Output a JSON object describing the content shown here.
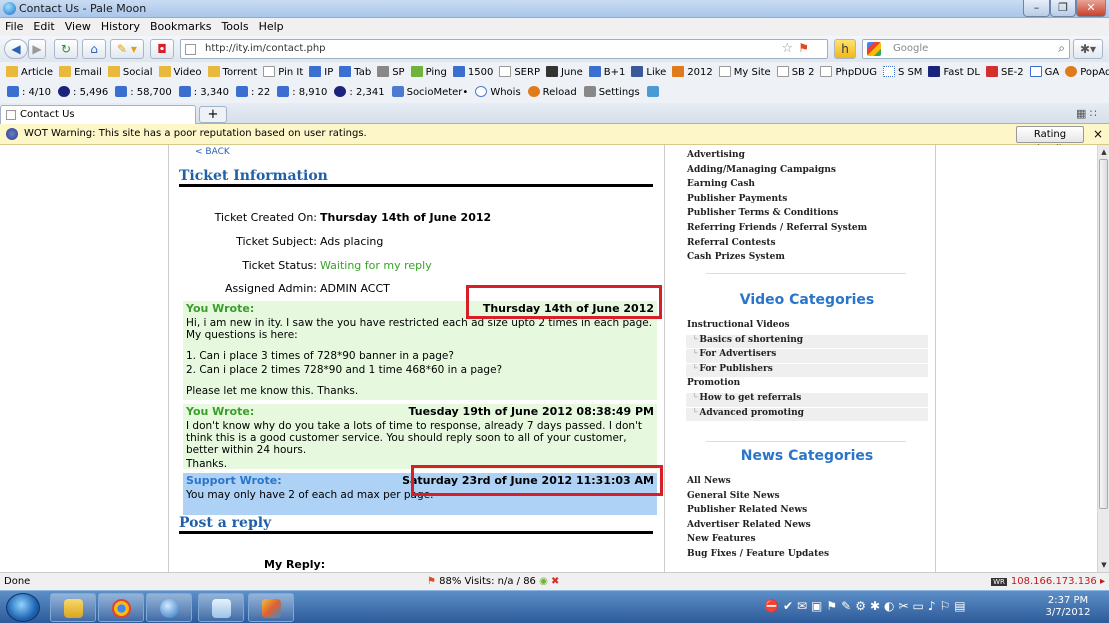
{
  "window": {
    "title": "Contact Us - Pale Moon",
    "controls": [
      "–",
      "❐",
      "✕"
    ]
  },
  "menu": [
    "File",
    "Edit",
    "View",
    "History",
    "Bookmarks",
    "Tools",
    "Help"
  ],
  "nav": {
    "url": "http://ity.im/contact.php",
    "search_placeholder": "Google"
  },
  "bookmarks": [
    {
      "label": "Article",
      "color": "#e8b93b"
    },
    {
      "label": "Email",
      "color": "#e8b93b"
    },
    {
      "label": "Social",
      "color": "#e8b93b"
    },
    {
      "label": "Video",
      "color": "#e8b93b"
    },
    {
      "label": "Torrent",
      "color": "#e8b93b"
    },
    {
      "label": "Pin It",
      "color": "#ffffff"
    },
    {
      "label": "IP",
      "color": "#3a6fd1"
    },
    {
      "label": "Tab",
      "color": "#3a6fd1"
    },
    {
      "label": "SP",
      "color": "#888888"
    },
    {
      "label": "Ping",
      "color": "#6fb33a"
    },
    {
      "label": "1500",
      "color": "#3a6fd1"
    },
    {
      "label": "SERP",
      "color": "#ffffff"
    },
    {
      "label": "June",
      "color": "#333333"
    },
    {
      "label": "B+1",
      "color": "#3a6fd1"
    },
    {
      "label": "Like",
      "color": "#3b5998"
    },
    {
      "label": "2012",
      "color": "#3a6fd1"
    },
    {
      "label": "My Site",
      "color": "#ffffff"
    },
    {
      "label": "SB 2",
      "color": "#ffffff"
    },
    {
      "label": "PhpDUG",
      "color": "#ffffff"
    },
    {
      "label": "S SM",
      "color": "#3a6fd1"
    },
    {
      "label": "Fast DL",
      "color": "#1a237e"
    },
    {
      "label": "SE-2",
      "color": "#d32f2f"
    },
    {
      "label": "GA",
      "color": "#3a6fd1"
    },
    {
      "label": "PopAds",
      "color": "#e07a1b"
    }
  ],
  "stats": [
    {
      "label": ": 4/10",
      "color": "#3a6fd1"
    },
    {
      "label": ": 5,496",
      "color": "#1a237e"
    },
    {
      "label": ": 58,700",
      "color": "#3a6fd1"
    },
    {
      "label": ": 3,340",
      "color": "#3a6fd1"
    },
    {
      "label": ": 22",
      "color": "#3a6fd1"
    },
    {
      "label": ": 8,910",
      "color": "#3a6fd1"
    },
    {
      "label": ": 2,341",
      "color": "#1a237e"
    },
    {
      "label": "SocioMeter•",
      "color": "#4a7bd0"
    },
    {
      "label": "Whois",
      "color": "#4a7bd0"
    },
    {
      "label": "Reload",
      "color": "#e07a1b"
    },
    {
      "label": "Settings",
      "color": "#888888"
    }
  ],
  "tab": {
    "label": "Contact Us",
    "new_tab": "+"
  },
  "wot": {
    "warning": "WOT Warning: This site has a poor reputation based on user ratings.",
    "button": "Rating details",
    "close": "×"
  },
  "page": {
    "back": "< BACK",
    "ticket_title": "Ticket Information",
    "info": [
      {
        "label": "Ticket Created On:",
        "value": "Thursday 14th of June 2012",
        "style": "bold"
      },
      {
        "label": "Ticket Subject:",
        "value": "Ads placing",
        "style": ""
      },
      {
        "label": "Ticket Status:",
        "value": "Waiting for my reply",
        "style": "green"
      },
      {
        "label": "Assigned Admin:",
        "value": "ADMIN ACCT",
        "style": ""
      }
    ],
    "messages": [
      {
        "who": "You Wrote:",
        "when": "Thursday 14th of June 2012",
        "lines": [
          "Hi, i am new in ity. I saw the you have restricted each ad size upto 2 times in each page. My questions is here:",
          "",
          "1. Can i place 3 times of 728*90 banner in a page?",
          "2. Can i place 2 times 728*90 and 1 time 468*60 in a page?",
          "",
          "Please let me know this. Thanks."
        ]
      },
      {
        "who": "You Wrote:",
        "when": "Tuesday 19th of June 2012 08:38:49 PM",
        "lines": [
          "I don't know why do you take a lots of time to response, already 7 days passed. I don't think this is a good customer service. You should reply soon to all of your customer, better within 24 hours.",
          "Thanks."
        ]
      },
      {
        "who": "Support Wrote:",
        "when": "Saturday 23rd of June 2012 11:31:03 AM",
        "lines": [
          "You may only have 2 of each ad max per page."
        ]
      }
    ],
    "reply_title": "Post a reply",
    "reply_label": "My Reply:"
  },
  "sidebar": {
    "top_items": [
      "Advertising",
      "Adding/Managing Campaigns",
      "Earning Cash",
      "Publisher Payments",
      "Publisher Terms & Conditions",
      "Referring Friends / Referral System",
      "Referral Contests",
      "Cash Prizes System"
    ],
    "video_title": "Video Categories",
    "video_items": [
      {
        "label": "Instructional Videos",
        "sub": false
      },
      {
        "label": "Basics of shortening",
        "sub": true
      },
      {
        "label": "For Advertisers",
        "sub": true
      },
      {
        "label": "For Publishers",
        "sub": true
      },
      {
        "label": "Promotion",
        "sub": false
      },
      {
        "label": "How to get referrals",
        "sub": true
      },
      {
        "label": "Advanced promoting",
        "sub": true
      }
    ],
    "news_title": "News Categories",
    "news_items": [
      "All News",
      "General Site News",
      "Publisher Related News",
      "Advertiser Related News",
      "New Features",
      "Bug Fixes / Feature Updates"
    ]
  },
  "status": {
    "left": "Done",
    "middle": "88%  Visits: n/a / 86",
    "ip": "108.166.173.136"
  },
  "taskbar": {
    "time": "2:37 PM",
    "date": "3/7/2012"
  }
}
